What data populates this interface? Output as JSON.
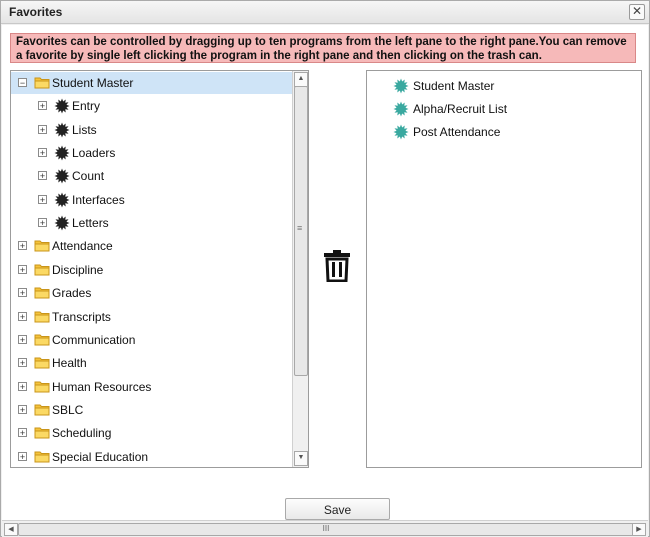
{
  "dialog": {
    "title": "Favorites",
    "close_glyph": "✕",
    "instructions": "Favorites can be controlled by dragging up to ten programs from the left pane to the right pane.You can remove a favorite by single left clicking the program in the right pane and then clicking on the trash can.",
    "save_label": "Save"
  },
  "tree": {
    "expanded": {
      "label": "Student Master",
      "toggle": "−",
      "icon": "folder-icon",
      "selected": true
    },
    "children": [
      {
        "label": "Entry",
        "toggle": "+",
        "icon": "gear-icon"
      },
      {
        "label": "Lists",
        "toggle": "+",
        "icon": "gear-icon"
      },
      {
        "label": "Loaders",
        "toggle": "+",
        "icon": "gear-icon"
      },
      {
        "label": "Count",
        "toggle": "+",
        "icon": "gear-icon"
      },
      {
        "label": "Interfaces",
        "toggle": "+",
        "icon": "gear-icon"
      },
      {
        "label": "Letters",
        "toggle": "+",
        "icon": "gear-icon"
      }
    ],
    "folders": [
      {
        "label": "Attendance",
        "toggle": "+"
      },
      {
        "label": "Discipline",
        "toggle": "+"
      },
      {
        "label": "Grades",
        "toggle": "+"
      },
      {
        "label": "Transcripts",
        "toggle": "+"
      },
      {
        "label": "Communication",
        "toggle": "+"
      },
      {
        "label": "Health",
        "toggle": "+"
      },
      {
        "label": "Human Resources",
        "toggle": "+"
      },
      {
        "label": "SBLC",
        "toggle": "+"
      },
      {
        "label": "Scheduling",
        "toggle": "+"
      },
      {
        "label": "Special Education",
        "toggle": "+"
      }
    ]
  },
  "favorites": [
    {
      "label": "Student Master",
      "icon": "gear-icon"
    },
    {
      "label": "Alpha/Recruit List",
      "icon": "gear-icon"
    },
    {
      "label": "Post Attendance",
      "icon": "gear-icon"
    }
  ],
  "scrollbar": {
    "up": "▲",
    "down": "▼",
    "grip": "≡",
    "left": "◀",
    "right": "▶",
    "hgrip": "III"
  },
  "colors": {
    "banner": "#f6b9b9",
    "selection": "#cfe4f7",
    "folder": "#f5c33b",
    "gear_dark": "#222222",
    "gear_teal": "#3aa9a0"
  }
}
